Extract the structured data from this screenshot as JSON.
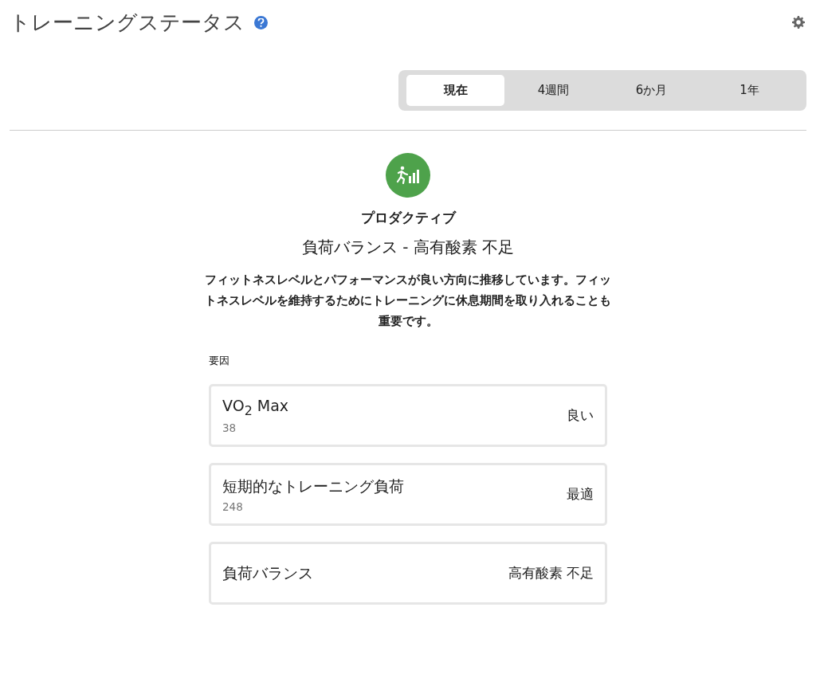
{
  "header": {
    "title": "トレーニングステータス"
  },
  "tabs": [
    {
      "label": "現在",
      "selected": true
    },
    {
      "label": "4週間",
      "selected": false
    },
    {
      "label": "6か月",
      "selected": false
    },
    {
      "label": "1年",
      "selected": false
    }
  ],
  "status": {
    "color": "#4ea24b",
    "name": "プロダクティブ",
    "subtitle": "負荷バランス - 高有酸素 不足",
    "description": "フィットネスレベルとパフォーマンスが良い方向に推移しています。フィットネスレベルを維持するためにトレーニングに休息期間を取り入れることも重要です。"
  },
  "factors_heading": "要因",
  "factors": [
    {
      "name": "VO$_{2}$ Max",
      "value": "38",
      "rating": "良い"
    },
    {
      "name": "短期的なトレーニング負荷",
      "value": "248",
      "rating": "最適"
    },
    {
      "name": "負荷バランス",
      "rating": "高有酸素 不足"
    }
  ]
}
